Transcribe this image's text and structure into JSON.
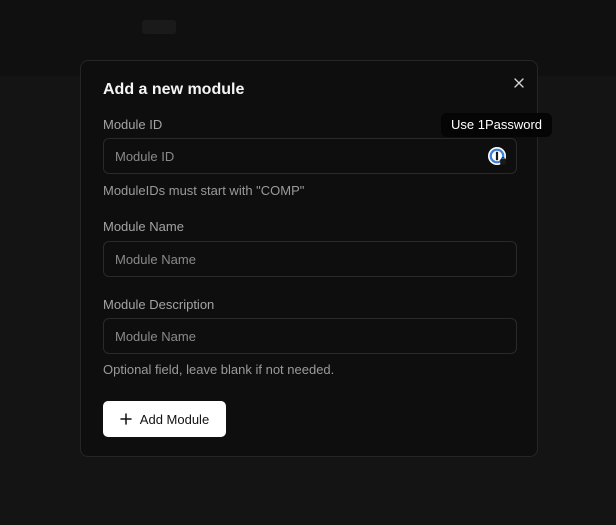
{
  "modal": {
    "title": "Add a new module",
    "close_icon": "close-icon"
  },
  "fields": {
    "module_id": {
      "label": "Module ID",
      "placeholder": "Module ID",
      "hint": "ModuleIDs must start with \"COMP\""
    },
    "module_name": {
      "label": "Module Name",
      "placeholder": "Module Name"
    },
    "module_description": {
      "label": "Module Description",
      "placeholder": "Module Name",
      "hint": "Optional field, leave blank if not needed."
    }
  },
  "password_manager": {
    "icon": "1password-icon",
    "tooltip": "Use 1Password"
  },
  "actions": {
    "add_label": "Add Module",
    "add_icon": "plus-icon"
  },
  "colors": {
    "background": "#141414",
    "modal": "#0e0e0e",
    "button": "#ffffff",
    "accent": "#3b7fd9"
  }
}
